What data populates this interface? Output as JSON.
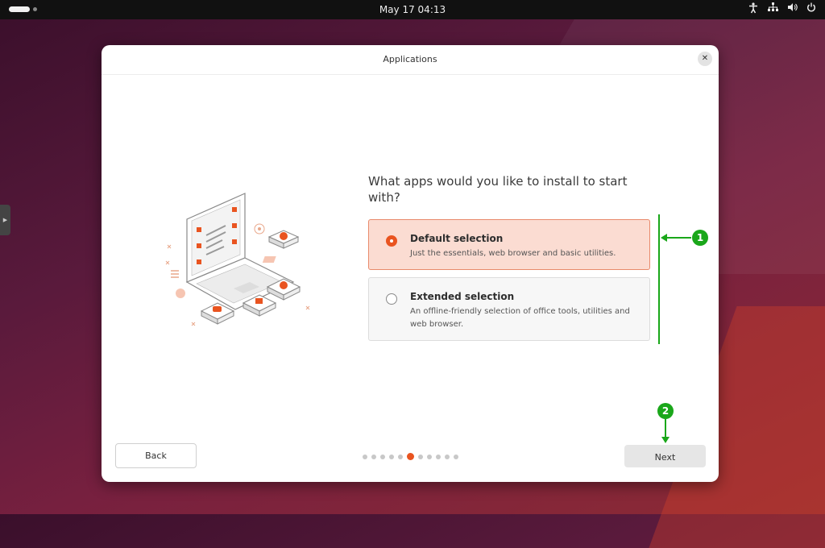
{
  "topbar": {
    "clock": "May 17  04:13",
    "tray_icons": [
      "accessibility-icon",
      "network-icon",
      "volume-icon",
      "power-icon"
    ]
  },
  "window": {
    "title": "Applications",
    "close_icon": "close-icon"
  },
  "main": {
    "question": "What apps would you like to install to start with?",
    "options": [
      {
        "title": "Default selection",
        "description": "Just the essentials, web browser and basic utilities.",
        "selected": true
      },
      {
        "title": "Extended selection",
        "description": "An offline-friendly selection of office tools, utilities and web browser.",
        "selected": false
      }
    ]
  },
  "footer": {
    "back_label": "Back",
    "next_label": "Next",
    "progress": {
      "total_steps": 11,
      "current_step": 6
    }
  },
  "annotations": [
    {
      "label": "1"
    },
    {
      "label": "2"
    }
  ],
  "colors": {
    "accent": "#e95420",
    "selected_bg": "#fbdcd2",
    "annotation": "#1aa71a"
  }
}
